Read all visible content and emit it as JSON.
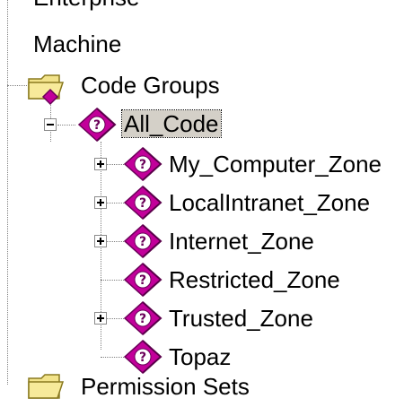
{
  "tree": {
    "enterprise": "Enterprise",
    "machine": "Machine",
    "code_groups": "Code Groups",
    "all_code": "All_Code",
    "children": [
      {
        "label": "My_Computer_Zone",
        "expandable": true
      },
      {
        "label": "LocalIntranet_Zone",
        "expandable": true
      },
      {
        "label": "Internet_Zone",
        "expandable": true
      },
      {
        "label": "Restricted_Zone",
        "expandable": false
      },
      {
        "label": "Trusted_Zone",
        "expandable": true
      },
      {
        "label": "Topaz",
        "expandable": false
      }
    ],
    "permission_sets": "Permission Sets"
  },
  "colors": {
    "diamond": "#c2009a",
    "diamond_shade": "#6a0058",
    "folder": "#f2e38a",
    "selection": "#d4d0c8"
  },
  "icons": {
    "code-group": "magenta-diamond-question",
    "folder": "yellow-folder"
  }
}
